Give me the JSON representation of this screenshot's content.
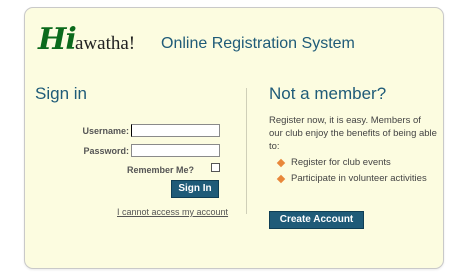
{
  "logo": {
    "hi": "Hi",
    "rest": "awatha!"
  },
  "app_title": "Online Registration System",
  "signin": {
    "heading": "Sign in",
    "username_label": "Username:",
    "username_value": "",
    "password_label": "Password:",
    "password_value": "",
    "remember_label": "Remember Me?",
    "remember_checked": false,
    "button_label": "Sign In",
    "access_link": "I cannot access my account"
  },
  "register": {
    "heading": "Not a member?",
    "intro": "Register now, it is easy. Members of our club enjoy the benefits of being able to:",
    "benefits": [
      "Register for club events",
      "Participate in volunteer activities"
    ],
    "button_label": "Create Account"
  },
  "colors": {
    "panel_bg": "#fcfce0",
    "accent": "#1f5b78",
    "logo_green": "#0b6a1c",
    "bullet": "#e8873a"
  }
}
